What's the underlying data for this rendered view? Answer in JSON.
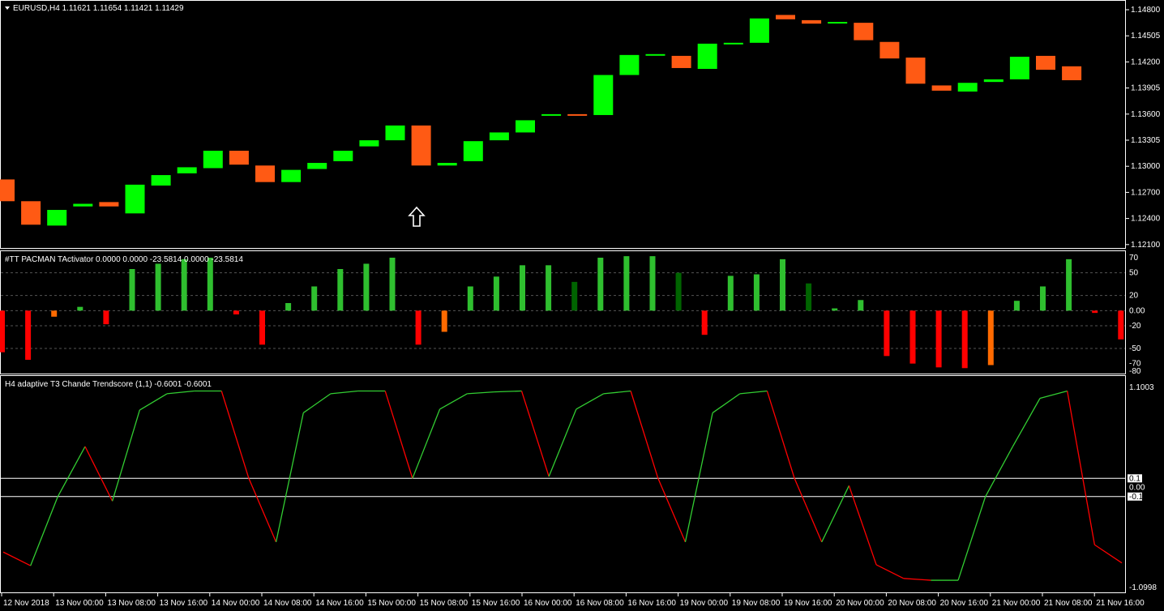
{
  "colors": {
    "background": "#000000",
    "frame": "#ffffff",
    "bull": "#00ff00",
    "bear": "#ff5a14",
    "hist_green": "#2fbf2f",
    "hist_dark_green": "#006400",
    "hist_red": "#ff0000",
    "hist_orange": "#ff6a00",
    "line_up": "#32cd32",
    "line_down": "#ff0000",
    "level_line": "#ffffff"
  },
  "main_panel": {
    "header": "EURUSD,H4  1.11621 1.11654 1.11421 1.11429",
    "price_axis": [
      "1.14800",
      "1.14505",
      "1.14200",
      "1.13905",
      "1.13600",
      "1.13305",
      "1.13000",
      "1.12700",
      "1.12400",
      "1.12100"
    ],
    "arrow_icon": "up-arrow-icon"
  },
  "indicator1": {
    "header": "#TT PACMAN TActivator 0.0000 0.0000 -23.5814 0.0000 -23.5814",
    "axis_labels": [
      "70",
      "50",
      "20",
      "0.00",
      "-20",
      "-50",
      "-70",
      "-80"
    ]
  },
  "indicator2": {
    "header": "H4   adaptive T3 Chande Trendscore (1,1) -0.6001 -0.6001",
    "axis_top": "1.1003",
    "axis_bottom": "-1.0998",
    "level_up": "0.1",
    "level_zero": "0.00",
    "level_down": "-0.1"
  },
  "time_axis": [
    "12 Nov 2018",
    "13 Nov 00:00",
    "13 Nov 08:00",
    "13 Nov 16:00",
    "14 Nov 00:00",
    "14 Nov 08:00",
    "14 Nov 16:00",
    "15 Nov 00:00",
    "15 Nov 08:00",
    "15 Nov 16:00",
    "16 Nov 00:00",
    "16 Nov 08:00",
    "16 Nov 16:00",
    "19 Nov 00:00",
    "19 Nov 08:00",
    "19 Nov 16:00",
    "20 Nov 00:00",
    "20 Nov 08:00",
    "20 Nov 16:00",
    "21 Nov 00:00",
    "21 Nov 08:00",
    "21 Nov 16:00"
  ],
  "chart_data": [
    {
      "type": "candlestick",
      "symbol": "EURUSD",
      "timeframe": "H4",
      "ylim": [
        1.121,
        1.148
      ],
      "candles": [
        {
          "o": 1.1285,
          "c": 1.126
        },
        {
          "o": 1.126,
          "c": 1.1233
        },
        {
          "o": 1.1232,
          "c": 1.125
        },
        {
          "o": 1.1254,
          "c": 1.1257
        },
        {
          "o": 1.1259,
          "c": 1.1254
        },
        {
          "o": 1.1246,
          "c": 1.1279
        },
        {
          "o": 1.1278,
          "c": 1.129
        },
        {
          "o": 1.1292,
          "c": 1.1299
        },
        {
          "o": 1.1298,
          "c": 1.1318
        },
        {
          "o": 1.1318,
          "c": 1.1302
        },
        {
          "o": 1.1301,
          "c": 1.1282
        },
        {
          "o": 1.1282,
          "c": 1.1296
        },
        {
          "o": 1.1297,
          "c": 1.1304
        },
        {
          "o": 1.1306,
          "c": 1.1318
        },
        {
          "o": 1.1323,
          "c": 1.133
        },
        {
          "o": 1.133,
          "c": 1.1347
        },
        {
          "o": 1.1347,
          "c": 1.1301
        },
        {
          "o": 1.1301,
          "c": 1.1304
        },
        {
          "o": 1.1306,
          "c": 1.1329
        },
        {
          "o": 1.133,
          "c": 1.1339
        },
        {
          "o": 1.1339,
          "c": 1.1353
        },
        {
          "o": 1.1359,
          "c": 1.136
        },
        {
          "o": 1.136,
          "c": 1.1359
        },
        {
          "o": 1.1359,
          "c": 1.1405
        },
        {
          "o": 1.1405,
          "c": 1.1428
        },
        {
          "o": 1.1428,
          "c": 1.1429
        },
        {
          "o": 1.1427,
          "c": 1.1413
        },
        {
          "o": 1.1412,
          "c": 1.1441
        },
        {
          "o": 1.1441,
          "c": 1.1442
        },
        {
          "o": 1.1442,
          "c": 1.147
        },
        {
          "o": 1.1474,
          "c": 1.1469
        },
        {
          "o": 1.1468,
          "c": 1.1464
        },
        {
          "o": 1.1465,
          "c": 1.1466
        },
        {
          "o": 1.1465,
          "c": 1.1445
        },
        {
          "o": 1.1443,
          "c": 1.1424
        },
        {
          "o": 1.1425,
          "c": 1.1395
        },
        {
          "o": 1.1393,
          "c": 1.1387
        },
        {
          "o": 1.1386,
          "c": 1.1396
        },
        {
          "o": 1.1397,
          "c": 1.14
        },
        {
          "o": 1.14,
          "c": 1.1426
        },
        {
          "o": 1.1427,
          "c": 1.1411
        },
        {
          "o": 1.1415,
          "c": 1.1399
        }
      ]
    },
    {
      "type": "bar",
      "title": "#TT PACMAN TActivator",
      "ylim": [
        -80,
        70
      ],
      "bars": [
        {
          "v": -55,
          "c": "red"
        },
        {
          "v": -65,
          "c": "red"
        },
        {
          "v": -8,
          "c": "orange"
        },
        {
          "v": 5,
          "c": "green"
        },
        {
          "v": -18,
          "c": "red"
        },
        {
          "v": 55,
          "c": "green"
        },
        {
          "v": 62,
          "c": "green"
        },
        {
          "v": 68,
          "c": "green"
        },
        {
          "v": 70,
          "c": "green"
        },
        {
          "v": -5,
          "c": "red"
        },
        {
          "v": -45,
          "c": "red"
        },
        {
          "v": 10,
          "c": "green"
        },
        {
          "v": 32,
          "c": "green"
        },
        {
          "v": 55,
          "c": "green"
        },
        {
          "v": 62,
          "c": "green"
        },
        {
          "v": 70,
          "c": "green"
        },
        {
          "v": -45,
          "c": "red"
        },
        {
          "v": -28,
          "c": "orange"
        },
        {
          "v": 32,
          "c": "green"
        },
        {
          "v": 45,
          "c": "green"
        },
        {
          "v": 60,
          "c": "green"
        },
        {
          "v": 60,
          "c": "green"
        },
        {
          "v": 38,
          "c": "darkgreen"
        },
        {
          "v": 70,
          "c": "green"
        },
        {
          "v": 72,
          "c": "green"
        },
        {
          "v": 72,
          "c": "green"
        },
        {
          "v": 50,
          "c": "darkgreen"
        },
        {
          "v": -32,
          "c": "red"
        },
        {
          "v": 46,
          "c": "green"
        },
        {
          "v": 48,
          "c": "green"
        },
        {
          "v": 68,
          "c": "green"
        },
        {
          "v": 36,
          "c": "darkgreen"
        },
        {
          "v": 3,
          "c": "green"
        },
        {
          "v": 14,
          "c": "green"
        },
        {
          "v": -60,
          "c": "red"
        },
        {
          "v": -70,
          "c": "red"
        },
        {
          "v": -75,
          "c": "red"
        },
        {
          "v": -76,
          "c": "red"
        },
        {
          "v": -72,
          "c": "orange"
        },
        {
          "v": 13,
          "c": "green"
        },
        {
          "v": 32,
          "c": "green"
        },
        {
          "v": 68,
          "c": "green"
        },
        {
          "v": -3,
          "c": "red"
        },
        {
          "v": -38,
          "c": "red"
        }
      ]
    },
    {
      "type": "line",
      "title": "adaptive T3 Chande Trendscore (1,1)",
      "ylim": [
        -1.0998,
        1.1003
      ],
      "levels": [
        0.1,
        0.0,
        -0.1
      ],
      "points": [
        -0.71,
        -0.86,
        -0.1,
        0.45,
        -0.15,
        0.85,
        1.03,
        1.06,
        1.06,
        0.1,
        -0.6,
        0.82,
        1.03,
        1.06,
        1.06,
        0.1,
        0.86,
        1.03,
        1.05,
        1.06,
        0.12,
        0.86,
        1.03,
        1.06,
        0.1,
        -0.6,
        0.82,
        1.03,
        1.06,
        0.1,
        -0.6,
        0.02,
        -0.85,
        -1.0,
        -1.02,
        -1.02,
        -0.1,
        0.45,
        0.98,
        1.06,
        -0.63,
        -0.83
      ]
    }
  ]
}
